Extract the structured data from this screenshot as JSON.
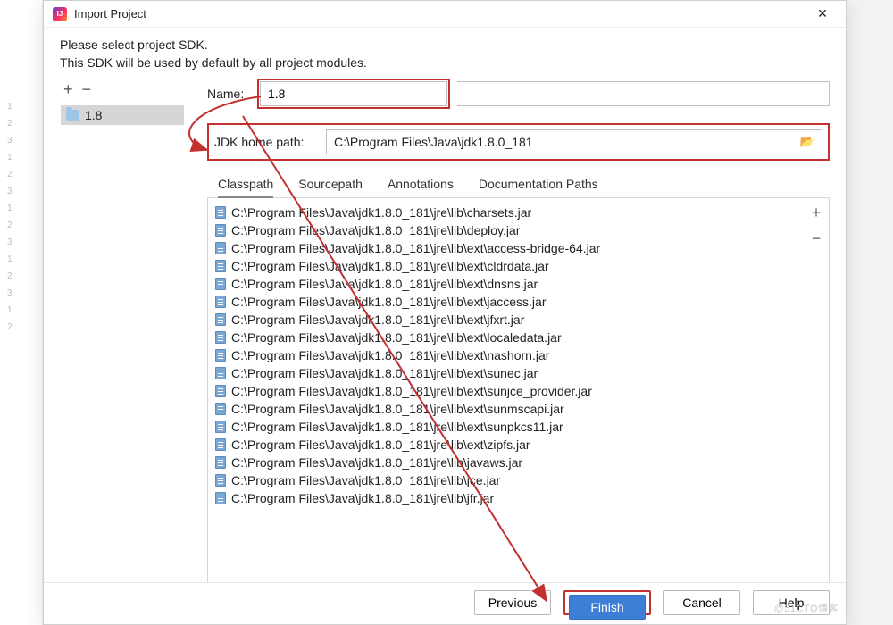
{
  "window": {
    "title": "Import Project",
    "close": "✕"
  },
  "instructions": {
    "line1": "Please select project SDK.",
    "line2": "This SDK will be used by default by all project modules."
  },
  "toolbar": {
    "add": "+",
    "remove": "−"
  },
  "tree": {
    "selected": "1.8"
  },
  "form": {
    "name_label": "Name:",
    "name_value": "1.8",
    "jdk_label": "JDK home path:",
    "jdk_value": "C:\\Program Files\\Java\\jdk1.8.0_181"
  },
  "tabs": {
    "classpath": "Classpath",
    "sourcepath": "Sourcepath",
    "annotations": "Annotations",
    "docpaths": "Documentation Paths"
  },
  "classpath": {
    "add": "+",
    "remove": "−",
    "items": [
      "C:\\Program Files\\Java\\jdk1.8.0_181\\jre\\lib\\charsets.jar",
      "C:\\Program Files\\Java\\jdk1.8.0_181\\jre\\lib\\deploy.jar",
      "C:\\Program Files\\Java\\jdk1.8.0_181\\jre\\lib\\ext\\access-bridge-64.jar",
      "C:\\Program Files\\Java\\jdk1.8.0_181\\jre\\lib\\ext\\cldrdata.jar",
      "C:\\Program Files\\Java\\jdk1.8.0_181\\jre\\lib\\ext\\dnsns.jar",
      "C:\\Program Files\\Java\\jdk1.8.0_181\\jre\\lib\\ext\\jaccess.jar",
      "C:\\Program Files\\Java\\jdk1.8.0_181\\jre\\lib\\ext\\jfxrt.jar",
      "C:\\Program Files\\Java\\jdk1.8.0_181\\jre\\lib\\ext\\localedata.jar",
      "C:\\Program Files\\Java\\jdk1.8.0_181\\jre\\lib\\ext\\nashorn.jar",
      "C:\\Program Files\\Java\\jdk1.8.0_181\\jre\\lib\\ext\\sunec.jar",
      "C:\\Program Files\\Java\\jdk1.8.0_181\\jre\\lib\\ext\\sunjce_provider.jar",
      "C:\\Program Files\\Java\\jdk1.8.0_181\\jre\\lib\\ext\\sunmscapi.jar",
      "C:\\Program Files\\Java\\jdk1.8.0_181\\jre\\lib\\ext\\sunpkcs11.jar",
      "C:\\Program Files\\Java\\jdk1.8.0_181\\jre\\lib\\ext\\zipfs.jar",
      "C:\\Program Files\\Java\\jdk1.8.0_181\\jre\\lib\\javaws.jar",
      "C:\\Program Files\\Java\\jdk1.8.0_181\\jre\\lib\\jce.jar",
      "C:\\Program Files\\Java\\jdk1.8.0_181\\jre\\lib\\jfr.jar"
    ]
  },
  "buttons": {
    "previous": "Previous",
    "finish": "Finish",
    "cancel": "Cancel",
    "help": "Help"
  },
  "watermark": "@51CTO博客"
}
